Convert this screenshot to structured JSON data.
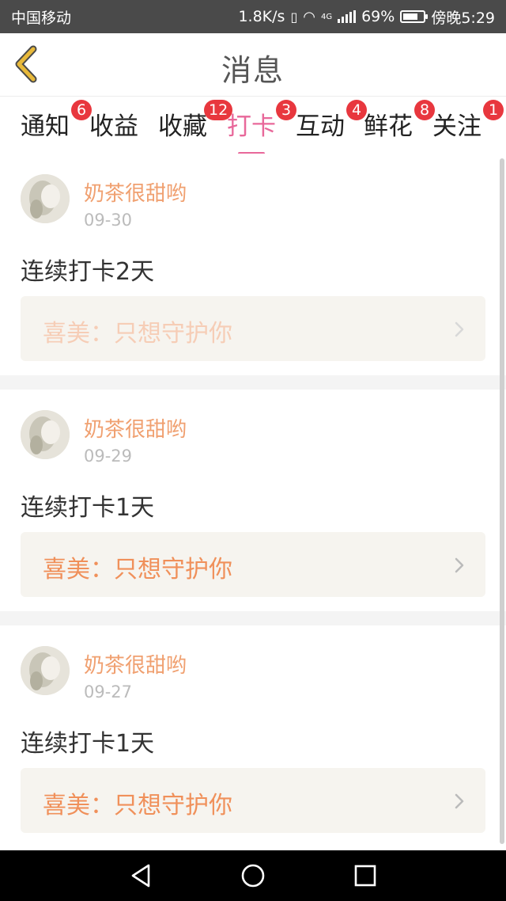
{
  "status_bar": {
    "carrier": "中国移动",
    "net_speed": "1.8K/s",
    "network_type": "4G",
    "battery": "69%",
    "time": "傍晚5:29"
  },
  "header": {
    "title": "消息",
    "back_icon": "chevron-left-icon",
    "accent_color": "#e8b93a"
  },
  "tabs": [
    {
      "label": "通知",
      "badge": "6"
    },
    {
      "label": "收益",
      "badge": ""
    },
    {
      "label": "收藏",
      "badge": "12"
    },
    {
      "label": "打卡",
      "badge": "3",
      "active": true
    },
    {
      "label": "互动",
      "badge": "4"
    },
    {
      "label": "鲜花",
      "badge": "8"
    },
    {
      "label": "关注",
      "badge": "1"
    }
  ],
  "colors": {
    "active_tab": "#e8689a",
    "badge": "#e8373e",
    "username": "#f0a070",
    "link": "#f0905a"
  },
  "messages": [
    {
      "username": "奶茶很甜哟",
      "date": "09-30",
      "text": "连续打卡2天",
      "link": "喜美：只想守护你"
    },
    {
      "username": "奶茶很甜哟",
      "date": "09-29",
      "text": "连续打卡1天",
      "link": "喜美：只想守护你"
    },
    {
      "username": "奶茶很甜哟",
      "date": "09-27",
      "text": "连续打卡1天",
      "link": "喜美：只想守护你"
    }
  ],
  "nav_bar": {
    "back": "triangle-back-icon",
    "home": "circle-home-icon",
    "recents": "square-recents-icon"
  }
}
